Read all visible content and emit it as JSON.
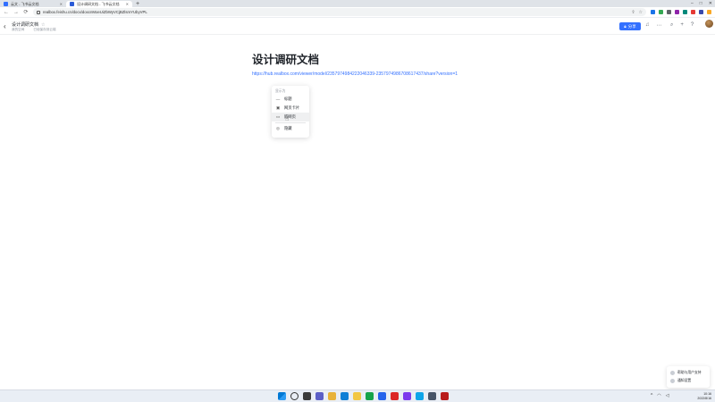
{
  "browser": {
    "tabs": [
      {
        "title": "云文 - 飞书云文档",
        "active": false
      },
      {
        "title": "设计调研文档 - 飞书云文档",
        "active": true
      }
    ],
    "new_tab": "+",
    "window_controls": [
      "–",
      "□",
      "✕"
    ],
    "url": "realbox.feishu.cn/docx/doxcnMoeUiZbWyVCjBZlsmYUbyVPL"
  },
  "doc_header": {
    "title": "设计调研文档",
    "meta_left": "我的空间",
    "meta_right": "已经保存到云端",
    "share_label": "分享"
  },
  "document": {
    "title": "设计调研文档",
    "link_text": "https://hub.realbox.com/viewer/model/2357974984222046339-2357974986708617437/share?version=1"
  },
  "popup": {
    "header": "显示为",
    "items": [
      {
        "label": "标题",
        "icon": "title-icon"
      },
      {
        "label": "网页卡片",
        "icon": "card-icon"
      },
      {
        "label": "嵌网页",
        "icon": "embed-icon"
      },
      {
        "label": "隐藏",
        "icon": "hide-icon"
      }
    ]
  },
  "help_widget": {
    "items": [
      "帮助与用户支持",
      "通知设置"
    ]
  },
  "taskbar": {
    "time": "10:16",
    "date": "2022/8/16"
  }
}
